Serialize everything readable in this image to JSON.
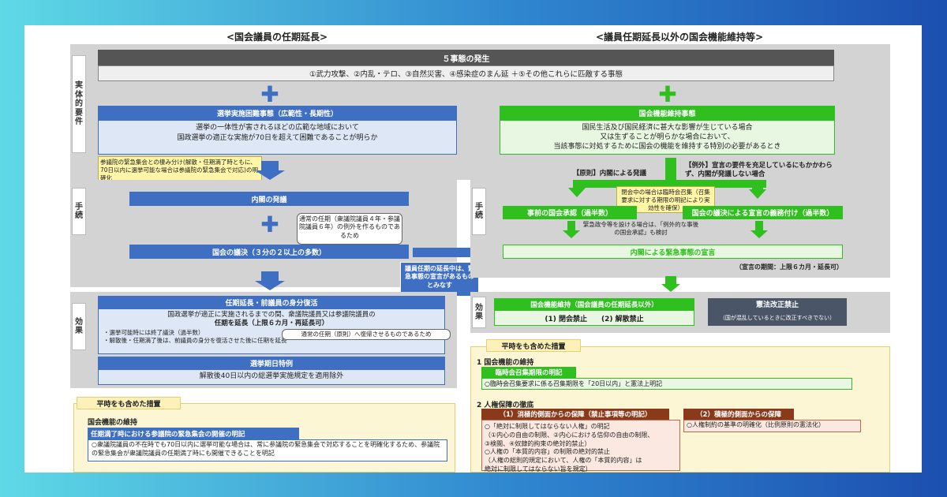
{
  "left_title": "<国会議員の任期延長>",
  "right_title": "<議員任期延長以外の国会機能維持等>",
  "side": {
    "actual": "実体的要件",
    "proc_left": "手続",
    "proc_right": "手続",
    "eff_left": "効果",
    "eff_right": "効果"
  },
  "events": {
    "title": "５事態の発生",
    "desc": "①武力攻撃、②内乱・テロ、③自然災害、④感染症のまん延 ＋⑤その他これらに匹敵する事態"
  },
  "left": {
    "req_header": "選挙実施困難事態（広範性・長期性）",
    "req_line1": "選挙の一体性が害されるほどの広範な地域において",
    "req_line2": "国政選挙の適正な実施が70日を超えて困難であることが明らか",
    "note_senate": "参議院の緊急集会との棲み分け(解散・任期満了時ともに、70日以内に選挙可能な場合は参議院の緊急集会で対応)の明確化",
    "proc_cabinet": "内閣の発議",
    "proc_note": "通常の任期（衆議院議員４年・参議院議員６年）の例外を作るものであるため",
    "proc_diet": "国会の議決（３分の２以上の多数）",
    "middle_note": "議員任期の延長中は、緊急事態の宣言があるものとみなす",
    "eff_header": "任期延長・前議員の身分復活",
    "eff_line1": "国政選挙が適正に実施されるまでの間、衆議院議員又は参議院議員の",
    "eff_line2": "任期を延長（上限６カ月・再延長可）",
    "eff_line3": "・選挙可能時には終了議決（過半数）",
    "eff_note": "通常の任期（原則）へ復帰させるものであるため",
    "eff_line4": "・解散後・任期満了後は、前議員の身分を復活させた後に任期を延長",
    "special_header": "選挙期日特例",
    "special_body": "解散後40日以内の総選挙実施規定を適用除外",
    "peace_tab": "平時をも含めた措置",
    "peace_title": "国会機能の維持",
    "peace_sub": "任期満了時における参議院の緊急集会の開催の明記",
    "peace_body": "○衆議院議員の不在時でも70日以内に選挙可能な場合は、常に参議院の緊急集会で対応することを明確化するため、参議院の緊急集会が衆議院議員の任期満了時にも開催できることを明記"
  },
  "right": {
    "req_header": "国会機能維持事態",
    "req_line1": "国民生活及び国民経済に甚大な影響が生じている場合",
    "req_line2": "又は生ずることが明らかな場合において、",
    "req_line3": "当該事態に対処するために国会の機能を維持する特別の必要があるとき",
    "principle": "【原則】内閣による発議",
    "exception": "【例外】宣言の要件を充足しているにもかかわらず、内閣が発議しない場合",
    "note_session": "閉会中の場合は臨時会召集（召集要求に対する期限の明記により実効性を確保）",
    "approval": "事前の国会承認（過半数）",
    "obligation": "国会の議決による宣言の義務付け（過半数）",
    "gov_note": "緊急政令等を設ける場合は、「例外的な事後の国会承認」も検討",
    "declaration": "内閣による緊急事態の宣言",
    "decl_period": "（宣言の期間：上限６カ月・延長可）",
    "eff_header": "国会機能維持（国会議員の任期延長以外）",
    "eff_body": "(1) 閉会禁止　　(2) 解散禁止",
    "amend_header": "憲法改正禁止",
    "amend_sub": "（国が混乱しているときに改正すべきでない）",
    "peace_tab": "平時をも含めた措置",
    "sec1": "1 国会機能の維持",
    "sec1_sub": "臨時会召集期限の明記",
    "sec1_body": "○臨時会召集要求に係る召集期限を「20日以内」と憲法上明記",
    "sec2": "2 人権保障の徹底",
    "sub1_header": "（1）消極的側面からの保障（禁止事項等の明記）",
    "sub1_l1": "○「絶対に制限してはならない人権」の明記",
    "sub1_l2": "（①内心の自由の制限、②内心における信仰の自由の制限、",
    "sub1_l3": "③検閲、④奴隷的拘束の絶対的禁止）",
    "sub1_l4": "○人権の「本質的内容」の制限の絶対的禁止",
    "sub1_l5": "（人権の総則的規定において、人権の「本質的内容」は",
    "sub1_l6": "絶対に制限してはならない旨を規定）",
    "sub2_header": "（2）積極的側面からの保障",
    "sub2_body": "○人権制約の基準の明確化（比例原則の憲法化）"
  },
  "colors": {
    "blue": "#3e6fc2",
    "green": "#2fbf1f",
    "dark": "#555555",
    "yellow": "#fdf6d4",
    "brown": "#8a3a1a"
  }
}
